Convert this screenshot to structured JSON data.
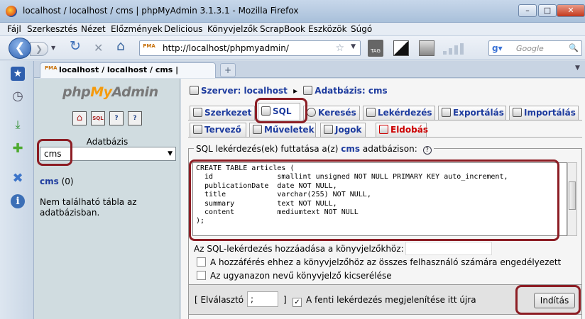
{
  "window": {
    "title": "localhost / localhost / cms | phpMyAdmin 3.1.3.1 - Mozilla Firefox",
    "minimize_glyph": "–",
    "maximize_glyph": "□",
    "close_glyph": "✕"
  },
  "menu": [
    "Fájl",
    "Szerkesztés",
    "Nézet",
    "Előzmények",
    "Delicious",
    "Könyvjelzők",
    "ScrapBook",
    "Eszközök",
    "Súgó"
  ],
  "nav": {
    "back_glyph": "❮",
    "forward_glyph": "❯",
    "reload_glyph": "↻",
    "stop_glyph": "✕",
    "home_glyph": "⌂",
    "url": "http://localhost/phpmyadmin/",
    "url_favicon_text": "PMA",
    "bookmark_star": "☆",
    "url_dropdown": "▼",
    "tag_label": "TAG",
    "search_engine": "g▾",
    "search_placeholder": "Google",
    "search_glyph": "🔍"
  },
  "browser_tab": {
    "label": "localhost / localhost / cms | phpMyAd...",
    "favicon_text": "PMA",
    "close_glyph": "×",
    "new_tab_glyph": "+"
  },
  "sidebar_icons": [
    "★",
    "◷",
    "⤓",
    "✚",
    "✖",
    "i"
  ],
  "left": {
    "logo_php": "php",
    "logo_my": "My",
    "logo_admin": "Admin",
    "quick_buttons": [
      "⌂",
      "SQL",
      "?",
      "?"
    ],
    "db_label": "Adatbázis",
    "db_selected": "cms",
    "db_arrow": "▼",
    "db_name": "cms",
    "db_count": "(0)",
    "no_tables": "Nem található tábla az adatbázisban."
  },
  "right": {
    "server_label": "Szerver: localhost",
    "crumb_sep": "▸",
    "db_crumb": "Adatbázis: cms",
    "tabs_row1": [
      "Szerkezet",
      "SQL",
      "Keresés",
      "Lekérdezés",
      "Exportálás",
      "Importálás"
    ],
    "tabs_row2": [
      "Tervező",
      "Műveletek",
      "Jogok",
      "Eldobás"
    ],
    "legend_prefix": "SQL lekérdezés(ek) futtatása a(z)",
    "legend_db": "cms",
    "legend_suffix": "adatbázison:",
    "help_glyph": "?",
    "sql_text": "CREATE TABLE articles (\n  id               smallint unsigned NOT NULL PRIMARY KEY auto_increment,\n  publicationDate  date NOT NULL,\n  title            varchar(255) NOT NULL,\n  summary          text NOT NULL,\n  content          mediumtext NOT NULL\n);",
    "bookmark_label": "Az SQL-lekérdezés hozzáadása a könyvjelzőkhöz:",
    "bookmark_value": "",
    "chk_all_users": "A hozzáférés ehhez a könyvjelzőhöz az összes felhasználó számára engedélyezett",
    "chk_replace": "Az ugyanazon nevű könyvjelző kicserélése",
    "delimiter_open": "[ Elválasztó",
    "delimiter_value": ";",
    "delimiter_close": "]",
    "show_query_check": "✓",
    "show_query_label": "A fenti lekérdezés megjelenítése itt újra",
    "go_button": "Indítás"
  },
  "colors": {
    "highlight": "#8c1d24",
    "link": "#1d3b9e",
    "drop_red": "#c00"
  }
}
